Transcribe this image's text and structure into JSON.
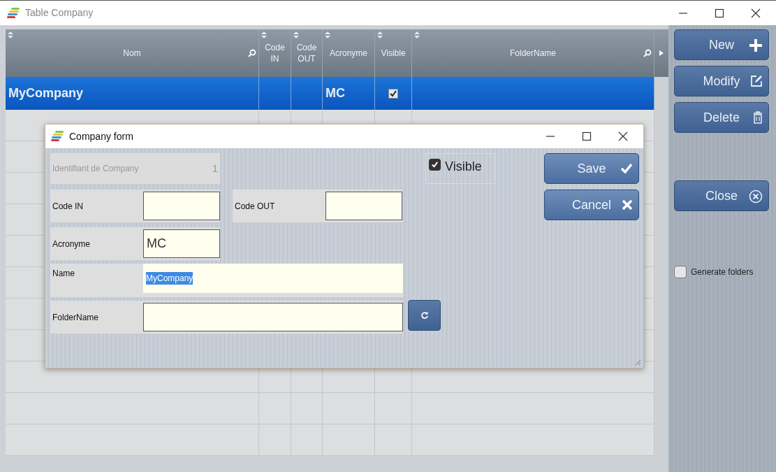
{
  "window": {
    "title": "Table Company"
  },
  "table": {
    "columns": [
      {
        "label": "Nom",
        "search": true
      },
      {
        "label": "Code IN",
        "search": false
      },
      {
        "label": "Code OUT",
        "search": false
      },
      {
        "label": "Acronyme",
        "search": false
      },
      {
        "label": "Visible",
        "search": false
      },
      {
        "label": "FolderName",
        "search": true
      }
    ],
    "rows": [
      {
        "nom": "MyCompany",
        "acronyme": "MC",
        "visible": true,
        "selected": true
      }
    ]
  },
  "side_buttons": [
    {
      "label": "New",
      "kind": "plus"
    },
    {
      "label": "Modify",
      "kind": "edit"
    },
    {
      "label": "Delete",
      "kind": "trash"
    },
    {
      "label": "Close",
      "kind": "close"
    }
  ],
  "generate_folders": {
    "label": "Generate folders",
    "checked": false
  },
  "dialog": {
    "title": "Company form",
    "id_field": {
      "label": "Identifiant de Company",
      "value": "1"
    },
    "visible": {
      "label": "Visible",
      "checked": true
    },
    "code_in": {
      "label": "Code IN"
    },
    "code_out": {
      "label": "Code OUT"
    },
    "acronyme": {
      "label": "Acronyme",
      "value": "MC"
    },
    "name": {
      "label": "Name",
      "value": "MyCompany",
      "text_selected": true
    },
    "folder_name": {
      "label": "FolderName"
    },
    "buttons": [
      {
        "label": "Save",
        "kind": "check"
      },
      {
        "label": "Cancel",
        "kind": "cross"
      }
    ]
  }
}
